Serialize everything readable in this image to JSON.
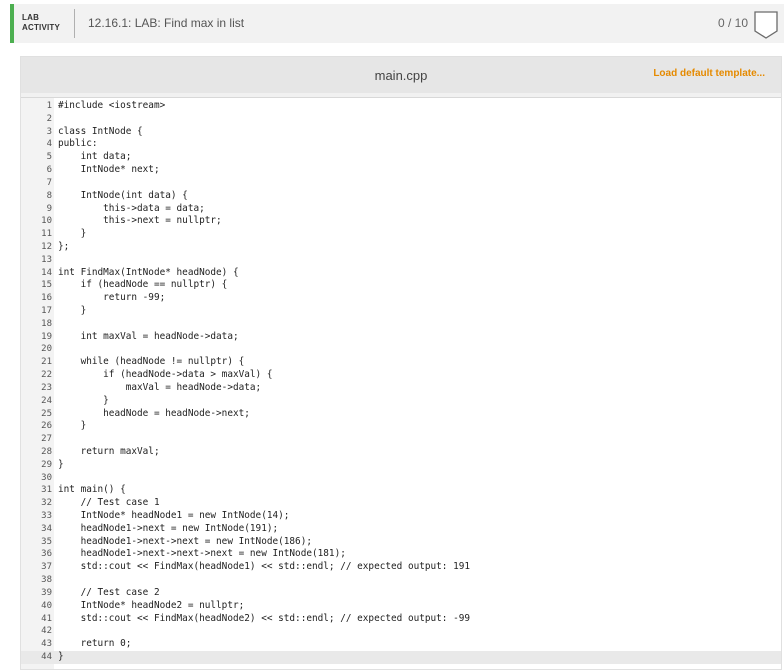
{
  "header": {
    "lab_line1": "LAB",
    "lab_line2": "ACTIVITY",
    "title": "12.16.1: LAB: Find max in list",
    "score": "0 / 10",
    "accent_color": "#4caf50"
  },
  "editor": {
    "filename": "main.cpp",
    "load_template": "Load default template...",
    "lines": [
      "#include <iostream>",
      "",
      "class IntNode {",
      "public:",
      "    int data;",
      "    IntNode* next;",
      "",
      "    IntNode(int data) {",
      "        this->data = data;",
      "        this->next = nullptr;",
      "    }",
      "};",
      "",
      "int FindMax(IntNode* headNode) {",
      "    if (headNode == nullptr) {",
      "        return -99;",
      "    }",
      "",
      "    int maxVal = headNode->data;",
      "",
      "    while (headNode != nullptr) {",
      "        if (headNode->data > maxVal) {",
      "            maxVal = headNode->data;",
      "        }",
      "        headNode = headNode->next;",
      "    }",
      "",
      "    return maxVal;",
      "}",
      "",
      "int main() {",
      "    // Test case 1",
      "    IntNode* headNode1 = new IntNode(14);",
      "    headNode1->next = new IntNode(191);",
      "    headNode1->next->next = new IntNode(186);",
      "    headNode1->next->next->next = new IntNode(181);",
      "    std::cout << FindMax(headNode1) << std::endl; // expected output: 191",
      "",
      "    // Test case 2",
      "    IntNode* headNode2 = nullptr;",
      "    std::cout << FindMax(headNode2) << std::endl; // expected output: -99",
      "",
      "    return 0;",
      "}"
    ]
  }
}
